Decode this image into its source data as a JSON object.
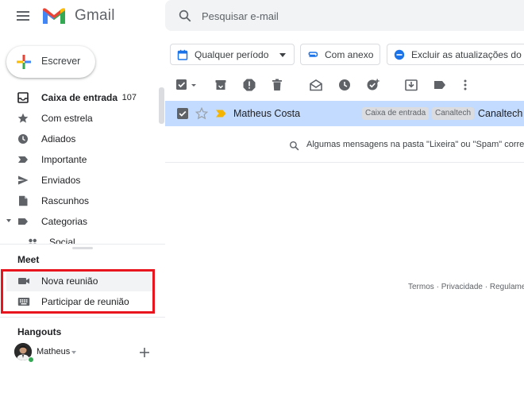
{
  "header": {
    "logo_text": "Gmail",
    "search_placeholder": "Pesquisar e-mail"
  },
  "compose": {
    "label": "Escrever"
  },
  "nav": {
    "items": [
      {
        "label": "Caixa de entrada",
        "count": "107",
        "icon": "inbox-icon"
      },
      {
        "label": "Com estrela",
        "icon": "star-icon"
      },
      {
        "label": "Adiados",
        "icon": "clock-icon"
      },
      {
        "label": "Importante",
        "icon": "important-icon"
      },
      {
        "label": "Enviados",
        "icon": "send-icon"
      },
      {
        "label": "Rascunhos",
        "icon": "draft-icon"
      },
      {
        "label": "Categorias",
        "icon": "label-icon"
      },
      {
        "label": "Social",
        "icon": "people-icon"
      }
    ]
  },
  "meet": {
    "title": "Meet",
    "items": [
      {
        "label": "Nova reunião",
        "icon": "video-camera-icon"
      },
      {
        "label": "Participar de reunião",
        "icon": "keyboard-icon"
      }
    ]
  },
  "hangouts": {
    "title": "Hangouts",
    "user": "Matheus"
  },
  "filters": {
    "any_time": "Qualquer período",
    "has_attachment": "Com anexo",
    "exclude_updates": "Excluir as atualizações do"
  },
  "email": {
    "sender": "Matheus Costa",
    "labels": [
      "Caixa de entrada",
      "Canaltech"
    ],
    "subject": "Canaltech -"
  },
  "info": {
    "message": "Algumas mensagens na pasta \"Lixeira\" ou \"Spam\" corre"
  },
  "footer": {
    "terms": "Termos",
    "sep1": " · ",
    "privacy": "Privacidade",
    "sep2": " · ",
    "rules": "Regulame"
  },
  "colors": {
    "selected_row": "#c2dbff",
    "highlight_box": "#e8141e",
    "accent_blue": "#1a73e8",
    "important_yellow": "#f4b400"
  }
}
